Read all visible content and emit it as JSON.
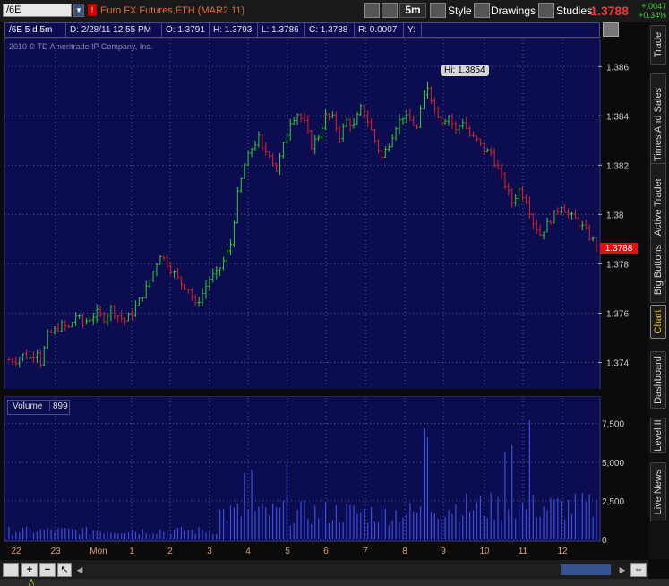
{
  "toolbar": {
    "symbol": "/6E",
    "title": "Euro FX Futures,ETH (MAR2 11)",
    "aggregation": "5m",
    "style_label": "Style",
    "drawings_label": "Drawings",
    "studies_label": "Studies",
    "last_price": "1.3788",
    "net_change": "+.0047",
    "pct_change": "+0.34%"
  },
  "info_bar": {
    "period": "/6E 5 d 5m",
    "date": "D: 2/28/11 12:55 PM",
    "open": "O: 1.3791",
    "high": "H: 1.3793",
    "low": "L: 1.3786",
    "close": "C: 1.3788",
    "range": "R: 0.0007",
    "y": "Y:"
  },
  "copyright": "2010 © TD Ameritrade IP Company, Inc.",
  "hi_bubble": "Hi: 1.3854",
  "price_label": "1.3788",
  "volume_header": {
    "label": "Volume",
    "value": "899"
  },
  "side_tabs": [
    "Trade",
    "Times And Sales",
    "Active Trader",
    "Big Buttons",
    "Chart",
    "Dashboard",
    "Level II",
    "Live News"
  ],
  "colors": {
    "up": "#30d030",
    "down": "#e02020",
    "background": "#0c0c50",
    "volume": "#3c4cdc",
    "grid": "#5a5a96",
    "price_tag": "#e01010"
  },
  "chart_data": [
    {
      "type": "candlestick",
      "title": "/6E 5 d 5m",
      "ylim": [
        1.373,
        1.3871
      ],
      "y_ticks": [
        "1.374",
        "1.376",
        "1.378",
        "1.38",
        "1.382",
        "1.384",
        "1.386"
      ],
      "x_ticks": [
        "22",
        "23",
        "Mon",
        "1",
        "2",
        "3",
        "4",
        "5",
        "6",
        "7",
        "8",
        "9",
        "10",
        "11",
        "12"
      ],
      "grid": true,
      "path": [
        [
          0,
          1.3741
        ],
        [
          2,
          1.3741
        ],
        [
          4,
          1.3743
        ],
        [
          6,
          1.3742
        ],
        [
          8,
          1.3745
        ],
        [
          9,
          1.374
        ],
        [
          11,
          1.3751
        ],
        [
          13,
          1.3753
        ],
        [
          15,
          1.3755
        ],
        [
          17,
          1.3754
        ],
        [
          19,
          1.3759
        ],
        [
          21,
          1.3756
        ],
        [
          23,
          1.3758
        ],
        [
          25,
          1.376
        ],
        [
          27,
          1.3758
        ],
        [
          29,
          1.3762
        ],
        [
          31,
          1.3759
        ],
        [
          33,
          1.3757
        ],
        [
          35,
          1.376
        ],
        [
          37,
          1.3765
        ],
        [
          39,
          1.377
        ],
        [
          41,
          1.3777
        ],
        [
          43,
          1.3784
        ],
        [
          45,
          1.378
        ],
        [
          47,
          1.3776
        ],
        [
          49,
          1.3772
        ],
        [
          51,
          1.377
        ],
        [
          53,
          1.3763
        ],
        [
          55,
          1.3768
        ],
        [
          57,
          1.3774
        ],
        [
          59,
          1.3776
        ],
        [
          61,
          1.3781
        ],
        [
          63,
          1.3788
        ],
        [
          65,
          1.3808
        ],
        [
          67,
          1.382
        ],
        [
          69,
          1.3827
        ],
        [
          71,
          1.3831
        ],
        [
          72,
          1.3826
        ],
        [
          74,
          1.3825
        ],
        [
          76,
          1.3818
        ],
        [
          78,
          1.3828
        ],
        [
          80,
          1.3838
        ],
        [
          82,
          1.3841
        ],
        [
          84,
          1.3837
        ],
        [
          86,
          1.3828
        ],
        [
          88,
          1.3832
        ],
        [
          90,
          1.384
        ],
        [
          92,
          1.3839
        ],
        [
          94,
          1.3832
        ],
        [
          96,
          1.3838
        ],
        [
          98,
          1.3836
        ],
        [
          100,
          1.3843
        ],
        [
          102,
          1.3838
        ],
        [
          104,
          1.383
        ],
        [
          106,
          1.3823
        ],
        [
          108,
          1.3829
        ],
        [
          110,
          1.3836
        ],
        [
          112,
          1.384
        ],
        [
          114,
          1.3838
        ],
        [
          116,
          1.3835
        ],
        [
          118,
          1.3848
        ],
        [
          119,
          1.3852
        ],
        [
          121,
          1.3843
        ],
        [
          123,
          1.3838
        ],
        [
          125,
          1.384
        ],
        [
          127,
          1.3834
        ],
        [
          129,
          1.3838
        ],
        [
          131,
          1.3832
        ],
        [
          133,
          1.383
        ],
        [
          135,
          1.3826
        ],
        [
          137,
          1.3825
        ],
        [
          139,
          1.3818
        ],
        [
          141,
          1.3812
        ],
        [
          143,
          1.3805
        ],
        [
          145,
          1.381
        ],
        [
          147,
          1.3806
        ],
        [
          149,
          1.3797
        ],
        [
          151,
          1.3792
        ],
        [
          153,
          1.3796
        ],
        [
          155,
          1.38
        ],
        [
          157,
          1.3804
        ],
        [
          159,
          1.38
        ],
        [
          161,
          1.3798
        ],
        [
          163,
          1.3795
        ],
        [
          165,
          1.3791
        ],
        [
          167,
          1.3788
        ]
      ],
      "bar_count": 168
    },
    {
      "type": "bar",
      "title": "Volume",
      "ylim": [
        0,
        8000
      ],
      "y_ticks": [
        "0",
        "2,500",
        "5,000",
        "7,500"
      ],
      "peaks": [
        {
          "bar": 67,
          "value": 4300
        },
        {
          "bar": 69,
          "value": 4500
        },
        {
          "bar": 79,
          "value": 4900
        },
        {
          "bar": 118,
          "value": 7200
        },
        {
          "bar": 119,
          "value": 6600
        },
        {
          "bar": 141,
          "value": 5700
        },
        {
          "bar": 143,
          "value": 6100
        },
        {
          "bar": 148,
          "value": 7700
        }
      ]
    }
  ]
}
